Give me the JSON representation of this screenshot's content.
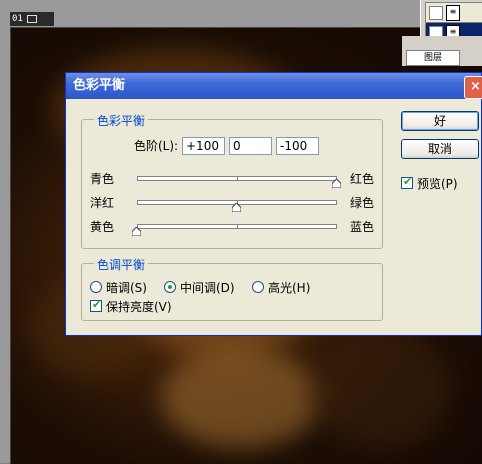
{
  "document": {
    "title_text": "01"
  },
  "layers_panel": {
    "tab_label": "图层"
  },
  "dialog": {
    "title": "色彩平衡",
    "color_balance": {
      "group_title": "色彩平衡",
      "levels_label": "色阶(L):",
      "levels_values": [
        "+100",
        "0",
        "-100"
      ],
      "sliders": [
        {
          "left_label": "青色",
          "right_label": "红色",
          "value": 100
        },
        {
          "left_label": "洋红",
          "right_label": "绿色",
          "value": 0
        },
        {
          "left_label": "黄色",
          "right_label": "蓝色",
          "value": -100
        }
      ]
    },
    "tone_balance": {
      "group_title": "色调平衡",
      "options": [
        "暗调(S)",
        "中间调(D)",
        "高光(H)"
      ],
      "selected": "中间调(D)",
      "preserve_luminosity_label": "保持亮度(V)",
      "preserve_luminosity_checked": true
    },
    "buttons": {
      "ok": "好",
      "cancel": "取消"
    },
    "preview_label": "预览(P)",
    "preview_checked": true
  }
}
